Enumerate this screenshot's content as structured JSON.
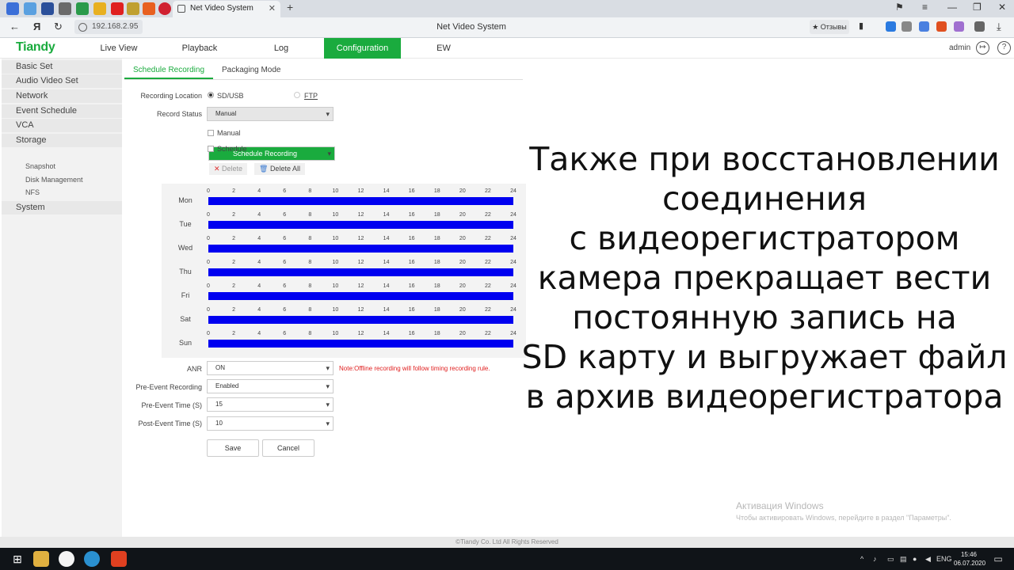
{
  "browser": {
    "tab_title": "Net Video System",
    "tab_close": "✕",
    "new_tab": "+",
    "url": "192.168.2.95",
    "page_title": "Net Video System",
    "reviews_label": "★ Отзывы"
  },
  "header": {
    "logo": "Tiandy",
    "nav": [
      "Live View",
      "Playback",
      "Log",
      "Configuration",
      "EW"
    ],
    "user": "admin"
  },
  "sidebar": {
    "items": [
      "Basic Set",
      "Audio Video Set",
      "Network",
      "Event Schedule",
      "VCA",
      "Storage"
    ],
    "storage_sub": [
      "Schedule Recording",
      "Snapshot",
      "Disk Management",
      "NFS"
    ],
    "last": "System"
  },
  "tabs": [
    "Schedule Recording",
    "Packaging Mode"
  ],
  "form": {
    "recording_location_label": "Recording Location",
    "loc_sd": "SD/USB",
    "loc_ftp": "FTP",
    "record_status_label": "Record Status",
    "record_status_value": "Manual",
    "manual_label": "Manual",
    "schedule_label": "Schedule",
    "delete_label": "Delete",
    "delete_all_label": "Delete All",
    "anr_label": "ANR",
    "anr_value": "ON",
    "note": "Note:Offline recording will follow timing recording rule.",
    "pre_event_label": "Pre-Event Recording",
    "pre_event_value": "Enabled",
    "pre_time_label": "Pre-Event Time (S)",
    "pre_time_value": "15",
    "post_time_label": "Post-Event Time (S)",
    "post_time_value": "10",
    "save": "Save",
    "cancel": "Cancel"
  },
  "schedule": {
    "days": [
      "Mon",
      "Tue",
      "Wed",
      "Thu",
      "Fri",
      "Sat",
      "Sun"
    ],
    "hour_ticks": [
      "0",
      "2",
      "4",
      "6",
      "8",
      "10",
      "12",
      "14",
      "16",
      "18",
      "20",
      "22",
      "24"
    ],
    "recording_hours": [
      0,
      24
    ],
    "bar_color": "#0000f0"
  },
  "overlay_text": [
    "Также при восстановлении",
    "соединения",
    "с видеорегистратором",
    "камера прекращает вести",
    "постоянную запись на",
    "SD карту и выгружает файл",
    "в архив видеорегистратора"
  ],
  "watermark": {
    "title": "Активация Windows",
    "subtitle": "Чтобы активировать Windows, перейдите в раздел \"Параметры\"."
  },
  "footer": "©Tiandy Co. Ltd All Rights Reserved",
  "taskbar": {
    "lang": "ENG",
    "time": "15:46",
    "date": "06.07.2020"
  },
  "colors": {
    "brand_green": "#1aab3e",
    "note_red": "#e02020"
  }
}
